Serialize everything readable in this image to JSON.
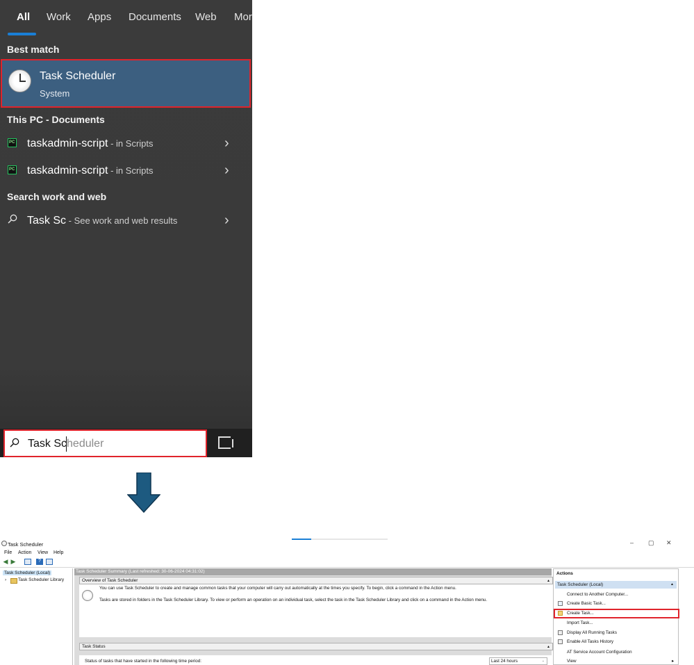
{
  "search_panel": {
    "tabs": [
      {
        "label": "All",
        "active": true
      },
      {
        "label": "Work",
        "active": false
      },
      {
        "label": "Apps",
        "active": false
      },
      {
        "label": "Documents",
        "active": false
      },
      {
        "label": "Web",
        "active": false
      },
      {
        "label": "Mor",
        "active": false
      }
    ],
    "best_match_heading": "Best match",
    "best_match": {
      "title": "Task Scheduler",
      "subtitle": "System",
      "icon": "clock-icon"
    },
    "documents_heading": "This PC - Documents",
    "documents": [
      {
        "name": "taskadmin-script",
        "location": " - in Scripts",
        "icon": "pycharm-file-icon"
      },
      {
        "name": "taskadmin-script",
        "location": " - in Scripts",
        "icon": "pycharm-file-icon"
      }
    ],
    "web_heading": "Search work and web",
    "web_result": {
      "query": "Task Sc",
      "suffix": " - See work and web results",
      "icon": "search-icon"
    },
    "search_box": {
      "typed": "Task Sc",
      "completion": "heduler"
    },
    "accent": "#1a7fd6",
    "highlight_color": "#e0232b"
  },
  "arrow": {
    "color": "#1d5a80"
  },
  "task_scheduler": {
    "window_title": "Task Scheduler",
    "window_controls": [
      "–",
      "▢",
      "✕"
    ],
    "menu": [
      "File",
      "Action",
      "View",
      "Help"
    ],
    "tree": [
      "Task Scheduler (Local)",
      "Task Scheduler Library"
    ],
    "summary_title": "Task Scheduler Summary (Last refreshed: 30-06-2024 04:31:02)",
    "overview_heading": "Overview of Task Scheduler",
    "overview_lines": [
      "You can use Task Scheduler to create and manage common tasks that your computer will carry out automatically at the times you specify. To begin, click a command in the Action menu.",
      "Tasks are stored in folders in the Task Scheduler Library. To view or perform an operation on an individual task, select the task in the Task Scheduler Library and click on a command in the Action menu."
    ],
    "status_heading": "Task Status",
    "status_text": "Status of tasks that have started in the following time period:",
    "status_period": "Last 24 hours",
    "actions_heading": "Actions",
    "actions_group": "Task Scheduler (Local)",
    "actions": [
      "Connect to Another Computer...",
      "Create Basic Task...",
      "Create Task...",
      "Import Task...",
      "Display All Running Tasks",
      "Enable All Tasks History",
      "AT Service Account Configuration",
      "View"
    ]
  }
}
